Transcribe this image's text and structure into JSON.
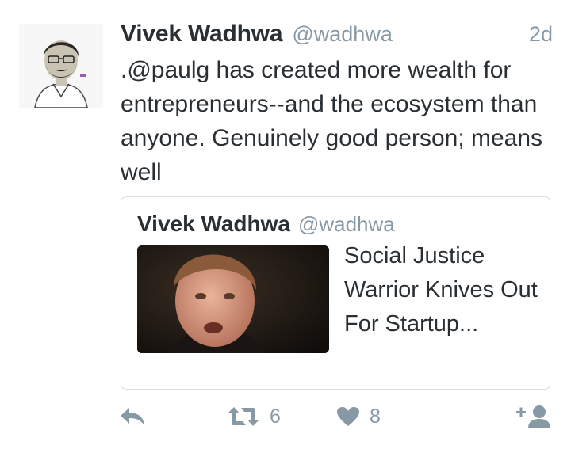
{
  "tweet": {
    "author_name": "Vivek Wadhwa",
    "author_handle": "@wadhwa",
    "timestamp": "2d",
    "text": ".@paulg has created more wealth for entrepreneurs--and the ecosystem than anyone. Genuinely good person; means well"
  },
  "quote": {
    "author_name": "Vivek Wadhwa",
    "author_handle": "@wadhwa",
    "title": "Social Justice Warrior Knives Out For Startup..."
  },
  "actions": {
    "reply_icon": "reply-icon",
    "retweet_icon": "retweet-icon",
    "retweet_count": "6",
    "like_icon": "heart-icon",
    "like_count": "8",
    "follow_icon": "follow-icon"
  },
  "colors": {
    "text": "#292f33",
    "muted": "#8899a6",
    "border": "#d8e0e6"
  }
}
